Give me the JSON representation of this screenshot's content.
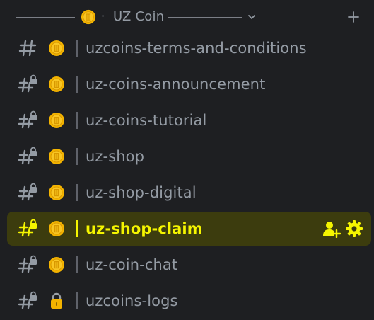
{
  "category": {
    "name": "UZ Coin",
    "separator": "·",
    "emoji_icon": "coin-emoji-icon",
    "chevron_icon": "chevron-down-icon",
    "add_icon": "plus-icon"
  },
  "colors": {
    "background": "#1e1f22",
    "muted_text": "#949ba4",
    "selected_bg": "#3c3c0e",
    "selected_text": "#f5f500",
    "coin_gold": "#f4b400"
  },
  "channels": [
    {
      "name": "uzcoins-terms-and-conditions",
      "emoji": "coin",
      "hash": "text-channel-icon",
      "locked": false
    },
    {
      "name": "uz-coins-announcement",
      "emoji": "coin",
      "hash": "locked-text-channel-icon",
      "locked": true
    },
    {
      "name": "uz-coins-tutorial",
      "emoji": "coin",
      "hash": "locked-text-channel-icon",
      "locked": true
    },
    {
      "name": "uz-shop",
      "emoji": "coin",
      "hash": "locked-text-channel-icon",
      "locked": true
    },
    {
      "name": "uz-shop-digital",
      "emoji": "coin",
      "hash": "locked-text-channel-icon",
      "locked": true
    },
    {
      "name": "uz-shop-claim",
      "emoji": "coin",
      "hash": "locked-text-channel-icon",
      "locked": true,
      "selected": true,
      "actions": [
        "invite-member-icon",
        "gear-icon"
      ]
    },
    {
      "name": "uz-coin-chat",
      "emoji": "coin",
      "hash": "locked-text-channel-icon",
      "locked": true
    },
    {
      "name": "uzcoins-logs",
      "emoji": "lock",
      "hash": "locked-text-channel-icon",
      "locked": true
    }
  ]
}
